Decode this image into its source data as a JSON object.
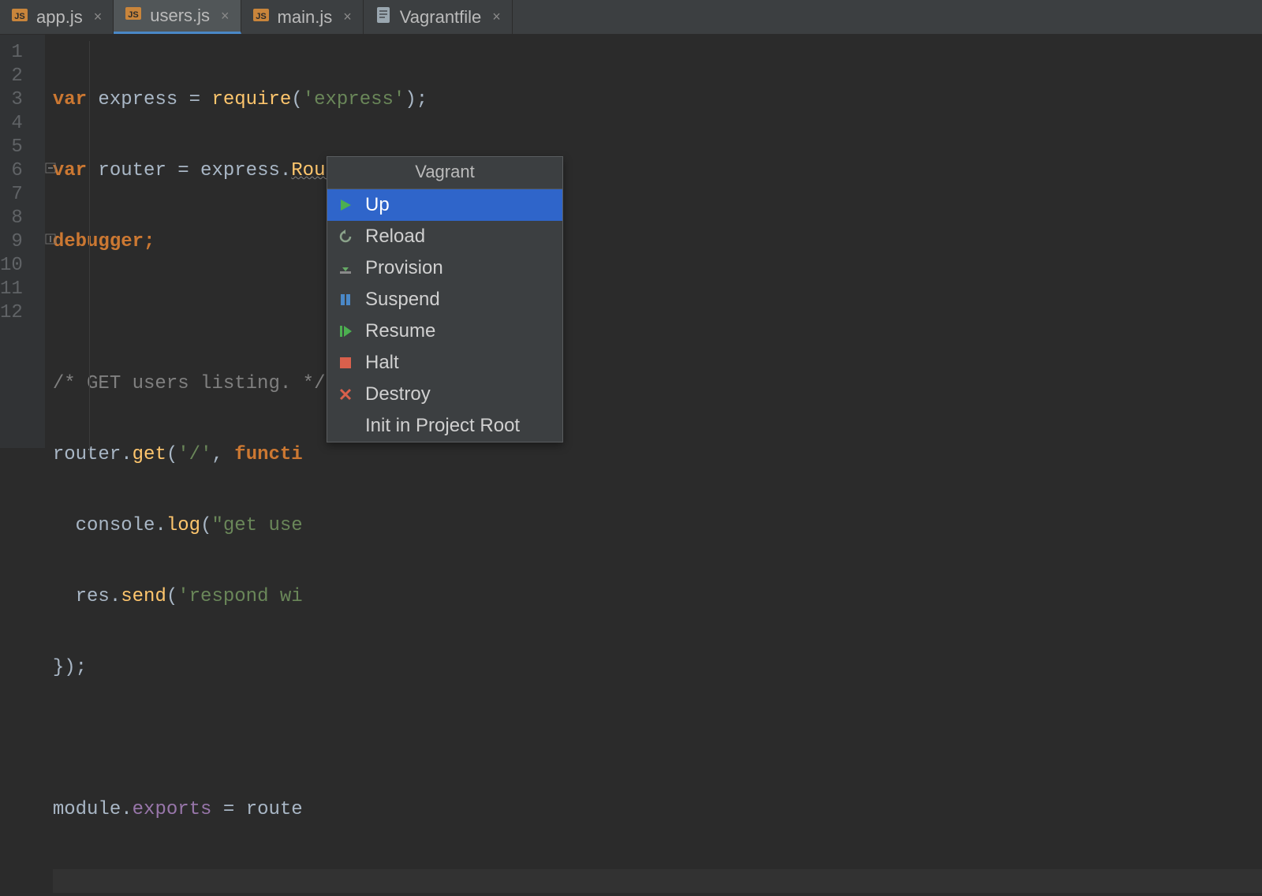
{
  "tabs": [
    {
      "label": "app.js",
      "type": "js",
      "active": false
    },
    {
      "label": "users.js",
      "type": "js",
      "active": true
    },
    {
      "label": "main.js",
      "type": "js",
      "active": false
    },
    {
      "label": "Vagrantfile",
      "type": "text",
      "active": false
    }
  ],
  "editor": {
    "line_numbers": [
      "1",
      "2",
      "3",
      "4",
      "5",
      "6",
      "7",
      "8",
      "9",
      "10",
      "11",
      "12"
    ],
    "current_line": 12,
    "fold_markers": [
      {
        "line": 6,
        "kind": "open"
      },
      {
        "line": 9,
        "kind": "close"
      }
    ],
    "code_text": [
      "var express = require('express');",
      "var router = express.Router();",
      "debugger;",
      "",
      "/* GET users listing. */",
      "router.get('/', functi",
      "  console.log(\"get use",
      "  res.send('respond wi",
      "});",
      "",
      "module.exports = route",
      ""
    ],
    "tokens": {
      "l1": {
        "kw1": "var",
        "id1": " express ",
        "op": "=",
        "fn": " require",
        "po": "(",
        "str": "'express'",
        "pc": ");"
      },
      "l2": {
        "kw1": "var",
        "id1": " router ",
        "op": "=",
        "id2": " express.",
        "fn": "Router",
        "pc": "();"
      },
      "l3": {
        "kw1": "debugger",
        "pc": ";"
      },
      "l5": {
        "cmt": "/* GET users listing. */"
      },
      "l6": {
        "id1": "router.",
        "fn": "get",
        "po": "(",
        "str": "'/'",
        "cm": ", ",
        "kw": "functi"
      },
      "l7": {
        "pad": "  ",
        "id1": "console.",
        "fn": "log",
        "po": "(",
        "str": "\"get use"
      },
      "l8": {
        "pad": "  ",
        "id1": "res.",
        "fn": "send",
        "po": "(",
        "str": "'respond wi"
      },
      "l9": {
        "pc": "});"
      },
      "l11": {
        "id1": "module.",
        "prop": "exports",
        "eq": " = ",
        "id2": "route"
      }
    }
  },
  "context_menu": {
    "title": "Vagrant",
    "items": [
      {
        "label": "Up",
        "icon": "play-icon",
        "selected": true
      },
      {
        "label": "Reload",
        "icon": "reload-icon",
        "selected": false
      },
      {
        "label": "Provision",
        "icon": "download-icon",
        "selected": false
      },
      {
        "label": "Suspend",
        "icon": "pause-icon",
        "selected": false
      },
      {
        "label": "Resume",
        "icon": "resume-icon",
        "selected": false
      },
      {
        "label": "Halt",
        "icon": "stop-icon",
        "selected": false
      },
      {
        "label": "Destroy",
        "icon": "destroy-icon",
        "selected": false
      },
      {
        "label": "Init in Project Root",
        "icon": "",
        "selected": false
      }
    ]
  },
  "colors": {
    "background": "#2b2b2b",
    "gutter": "#313335",
    "tabbar": "#3c3f41",
    "selection": "#2f65ca",
    "keyword": "#cc7832",
    "function": "#ffc66d",
    "string": "#6a8759",
    "comment": "#808080",
    "property": "#9876aa"
  }
}
